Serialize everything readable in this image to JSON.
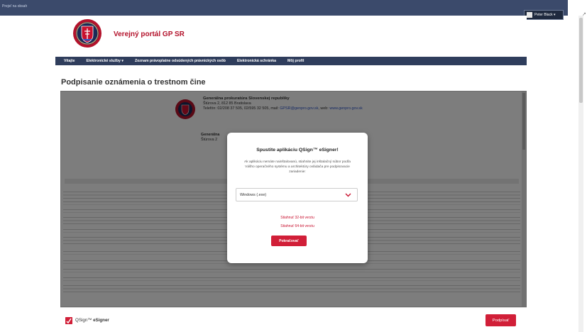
{
  "topbar": {
    "skip_label": "Prejsť na obsah",
    "user_label": "Peter Black ▾"
  },
  "header": {
    "site_title": "Verejný portál GP SR"
  },
  "nav": {
    "items": [
      {
        "label": "Vitajte"
      },
      {
        "label": "Elektronické služby ▾"
      },
      {
        "label": "Zoznam právoplatne odsúdených právnických osôb"
      },
      {
        "label": "Elektronická schránka"
      },
      {
        "label": "Môj profil"
      }
    ]
  },
  "page": {
    "title": "Podpisanie oznámenia o trestnom čine"
  },
  "document": {
    "org": {
      "name": "Generálna prokuratúra Slovenskej republiky",
      "address": "Štúrova 2, 812 85 Bratislava",
      "contact_prefix": "Telefón: 02/208 37 505, 02/595 32 505, mail: ",
      "email": "GPSR@genpro.gov.sk",
      "web_prefix": ", web: ",
      "web": "www.genpro.gov.sk"
    },
    "org2": {
      "name": "Generálna",
      "address": "Štúrova 2"
    }
  },
  "modal": {
    "title": "Spustite aplikáciu QSign™ eSigner!",
    "text": "Ak aplikáciu nemáte nainštalovanú, stiahnite jej inštalačný súbor podľa Vášho operačného systému a architektúry ovládača pre podpisovacie zariadenie:",
    "os_selected": "Windows (.exe)",
    "download_32": "Stiahnuť 32-bit verziu",
    "download_64": "Stiahnuť 64-bit verziu",
    "continue_label": "Pokračovať"
  },
  "footer": {
    "brand_prefix": "QSign™ ",
    "brand_name": "eSigner",
    "sign_label": "Podpísať"
  },
  "colors": {
    "accent": "#d11f38",
    "nav": "#2f3d5c",
    "title_red": "#b3122b"
  }
}
